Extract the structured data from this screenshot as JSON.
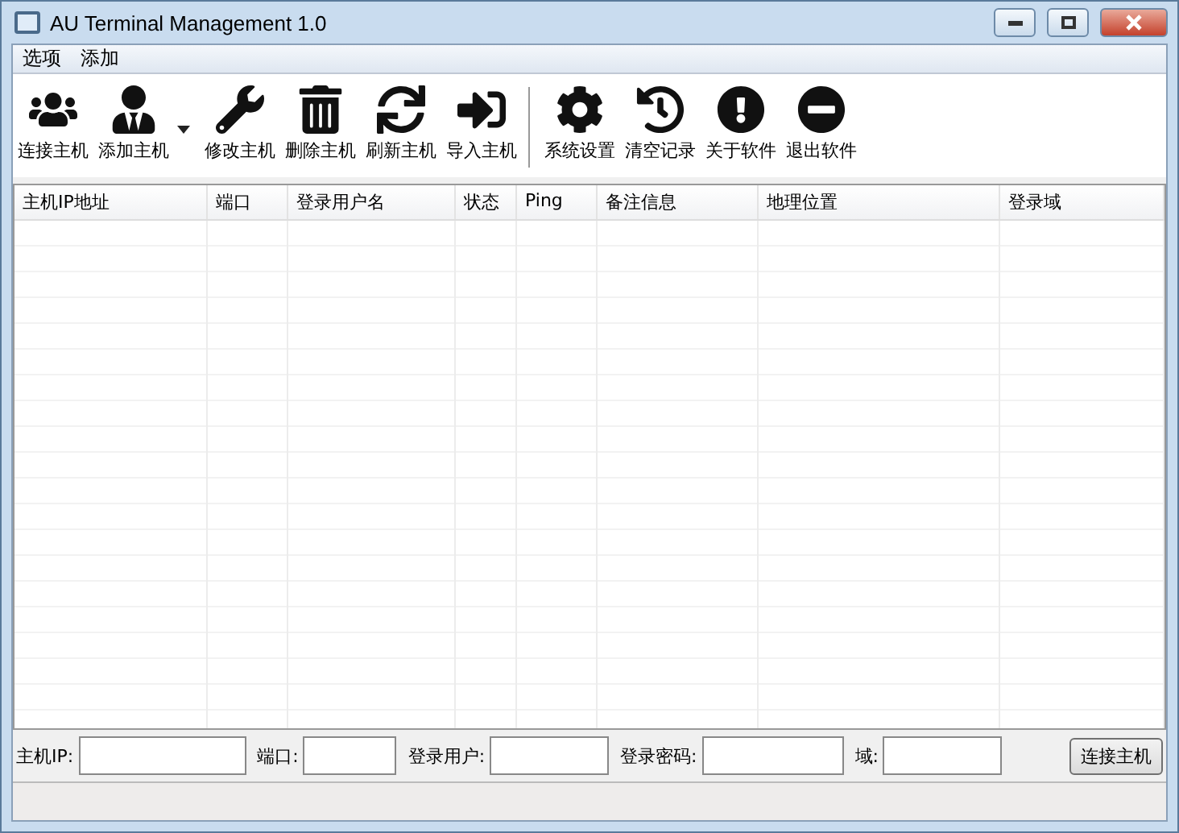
{
  "window": {
    "title": "AU Terminal Management 1.0"
  },
  "menu": [
    "选项",
    "添加"
  ],
  "toolbar": {
    "groups": [
      [
        {
          "label": "连接主机",
          "has_menu": false
        },
        {
          "label": "添加主机",
          "has_menu": true
        },
        {
          "label": "修改主机",
          "has_menu": false
        },
        {
          "label": "删除主机",
          "has_menu": false
        },
        {
          "label": "刷新主机",
          "has_menu": false
        },
        {
          "label": "导入主机",
          "has_menu": false
        }
      ],
      [
        {
          "label": "系统设置",
          "has_menu": false
        },
        {
          "label": "清空记录",
          "has_menu": false
        },
        {
          "label": "关于软件",
          "has_menu": false
        },
        {
          "label": "退出软件",
          "has_menu": false
        }
      ]
    ]
  },
  "table": {
    "columns": [
      "主机IP地址",
      "端口",
      "登录用户名",
      "状态",
      "Ping",
      "备注信息",
      "地理位置",
      "登录域"
    ]
  },
  "form": {
    "fields": [
      {
        "label": "主机IP:"
      },
      {
        "label": "端口:"
      },
      {
        "label": "登录用户:"
      },
      {
        "label": "登录密码:"
      },
      {
        "label": "域:"
      }
    ],
    "button": "连接主机"
  }
}
